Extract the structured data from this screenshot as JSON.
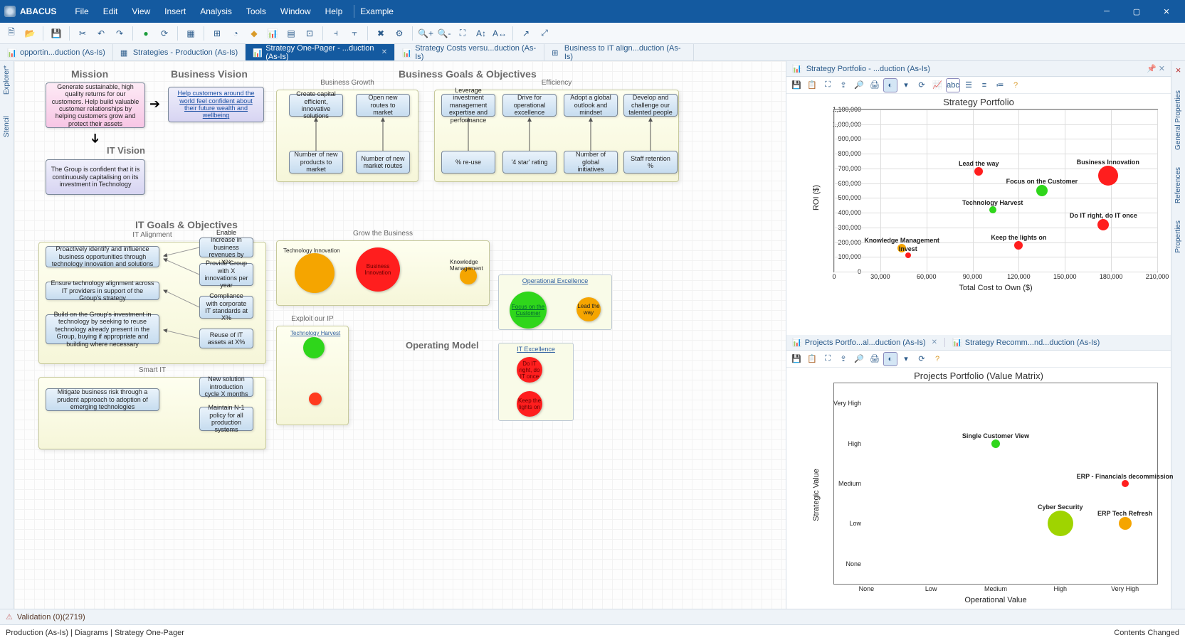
{
  "app": {
    "title": "ABACUS",
    "example": "Example"
  },
  "menus": [
    "File",
    "Edit",
    "View",
    "Insert",
    "Analysis",
    "Tools",
    "Window",
    "Help"
  ],
  "tabs": [
    {
      "label": "opportin...duction (As-Is)",
      "active": false,
      "icon": "chart"
    },
    {
      "label": "Strategies - Production (As-Is)",
      "active": false,
      "icon": "table"
    },
    {
      "label": "Strategy One-Pager - ...duction (As-Is)",
      "active": true,
      "icon": "chart",
      "closable": true
    },
    {
      "label": "Strategy Costs versu...duction (As-Is)",
      "active": false,
      "icon": "chart"
    },
    {
      "label": "Business to IT align...duction (As-Is)",
      "active": false,
      "icon": "matrix"
    }
  ],
  "leftrail": [
    "Explorer*",
    "Stencil"
  ],
  "rightrail": [
    "General Properties",
    "References",
    "Properties"
  ],
  "diagram": {
    "headings": {
      "mission": "Mission",
      "bvision": "Business Vision",
      "goals": "Business Goals & Objectives",
      "itvision": "IT Vision",
      "itgoals": "IT Goals & Objectives",
      "opmodel": "Operating Model"
    },
    "mission_text": "Generate sustainable, high quality returns for our customers. Help build valuable customer relationships by helping customers grow and protect their assets",
    "bvision_text": "Help customers around the world feel confident about their future wealth and wellbeing",
    "itvision_text": "The Group is confident that it is continuously capitalising on its investment in Technology",
    "bgrowth": {
      "name": "Business Growth",
      "obj1": "Create capital efficient, innovative solutions",
      "obj2": "Open new routes to market",
      "m1": "Number of new products to market",
      "m2": "Number of new market routes"
    },
    "efficiency": {
      "name": "Efficiency",
      "obj1": "Leverage investment management expertise and performance",
      "obj2": "Drive for operational excellence",
      "obj3": "Adopt a global outlook and mindset",
      "obj4": "Develop and challenge our talented people",
      "m1": "% re-use",
      "m2": "'4 star' rating",
      "m3": "Number of global initiatives",
      "m4": "Staff retention %"
    },
    "italign": {
      "name": "IT Alignment",
      "o1": "Proactively identify and influence business opportunities through technology innovation and solutions",
      "o2": "Ensure technology alignment across IT providers in support of the Group's strategy",
      "o3": "Build on the Group's investment in technology by seeking to reuse technology already present in the Group, buying if appropriate and building where necessary",
      "k1": "Enable increase in business revenues by X%",
      "k2": "Provide Group with X innovations per year",
      "k3": "Compliance with corporate IT standards at X%",
      "k4": "Reuse of IT assets at X%"
    },
    "smartit": {
      "name": "Smart IT",
      "o1": "Mitigate business risk through a prudent approach to adoption of emerging technologies",
      "k1": "New solution introduction cycle X months",
      "k2": "Maintain N-1 policy for all production systems"
    },
    "growbiz": {
      "name": "Grow the Business",
      "b1": "Technology Innovation",
      "b2": "Business Innovation",
      "b3": "Knowledge Management"
    },
    "exploit": {
      "name": "Exploit our IP",
      "b1": "Technology Harvest"
    },
    "opex": {
      "name": "Operational Excellence",
      "b1": "Focus on the Customer",
      "b2": "Lead the way"
    },
    "itex": {
      "name": "IT Excellence",
      "b1": "Do IT right, do IT once",
      "b2": "Keep the lights on"
    }
  },
  "panes": {
    "top": {
      "tab": "Strategy Portfolio - ...duction (As-Is)"
    },
    "bottom_tabs": [
      "Projects Portfo...al...duction (As-Is)",
      "Strategy Recomm...nd...duction (As-Is)"
    ]
  },
  "validation": "Validation  (0)(2719)",
  "breadcrumb": "Production (As-Is) | Diagrams | Strategy One-Pager",
  "status_right": "Contents Changed",
  "chart_data": [
    {
      "title": "Strategy Portfolio",
      "type": "bubble",
      "xlabel": "Total Cost to Own ($)",
      "ylabel": "ROI ($)",
      "xlim": [
        0,
        210000
      ],
      "ylim": [
        0,
        1100000
      ],
      "xticks": [
        0,
        30000,
        60000,
        90000,
        120000,
        150000,
        180000,
        210000
      ],
      "yticks": [
        0,
        100000,
        200000,
        300000,
        400000,
        500000,
        600000,
        700000,
        800000,
        900000,
        1000000,
        1100000
      ],
      "series": [
        {
          "name": "Lead the way",
          "x": 94000,
          "y": 680000,
          "size": 12,
          "color": "#ff1e1e"
        },
        {
          "name": "Business Innovation",
          "x": 178000,
          "y": 650000,
          "size": 28,
          "color": "#ff1e1e"
        },
        {
          "name": "Focus on the Customer",
          "x": 135000,
          "y": 550000,
          "size": 16,
          "color": "#2fd61b"
        },
        {
          "name": "Technology Harvest",
          "x": 103000,
          "y": 420000,
          "size": 10,
          "color": "#2fd61b"
        },
        {
          "name": "Do IT right, do IT once",
          "x": 175000,
          "y": 320000,
          "size": 16,
          "color": "#ff1e1e"
        },
        {
          "name": "Keep the lights on",
          "x": 120000,
          "y": 180000,
          "size": 12,
          "color": "#ff1e1e"
        },
        {
          "name": "Knowledge Management",
          "x": 44000,
          "y": 160000,
          "size": 12,
          "color": "#f5a500"
        },
        {
          "name": "Invest",
          "x": 48000,
          "y": 110000,
          "size": 8,
          "color": "#ff1e1e"
        }
      ]
    },
    {
      "title": "Projects Portfolio (Value Matrix)",
      "type": "bubble",
      "xlabel": "Operational Value",
      "ylabel": "Strategic Value",
      "x_categories": [
        "None",
        "Low",
        "Medium",
        "High",
        "Very High"
      ],
      "y_categories": [
        "None",
        "Low",
        "Medium",
        "High",
        "Very High"
      ],
      "series": [
        {
          "name": "Single Customer View",
          "x": "Medium",
          "y": "High",
          "size": 12,
          "color": "#2fd61b"
        },
        {
          "name": "ERP - Financials decommission",
          "x": "Very High",
          "y": "Medium",
          "size": 10,
          "color": "#ff1e1e"
        },
        {
          "name": "Cyber Security",
          "x": "High",
          "y": "Low",
          "size": 36,
          "color": "#9fd400"
        },
        {
          "name": "ERP Tech Refresh",
          "x": "Very High",
          "y": "Low",
          "size": 18,
          "color": "#f5a500"
        }
      ]
    }
  ]
}
